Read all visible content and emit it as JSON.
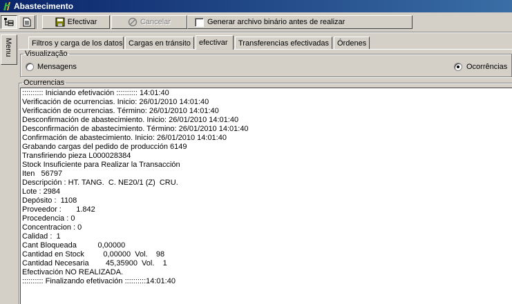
{
  "window": {
    "title": "Abastecimento"
  },
  "toolbar": {
    "efectivar_label": "Efectivar",
    "cancelar_label": "Cancelar",
    "binary_checkbox_label": "Generar archivo binário antes de realizar",
    "binary_checked": false
  },
  "sidebar": {
    "menu_label": "Menu"
  },
  "tabs": [
    {
      "label": "Filtros y carga de los datos",
      "active": false
    },
    {
      "label": "Cargas en tránsito",
      "active": false
    },
    {
      "label": "efectivar",
      "active": true
    },
    {
      "label": "Transferencias efectivadas",
      "active": false
    },
    {
      "label": "Órdenes",
      "active": false
    }
  ],
  "visualizacion": {
    "legend": "Visualização",
    "option_mensagens": "Mensagens",
    "option_ocorrencias": "Ocorrências",
    "selected": "Ocorrências"
  },
  "ocurrencias": {
    "legend": "Ocurrencias",
    "lines": [
      ":::::::::: Iniciando efetivación :::::::::: 14:01:40",
      "Verificación de ocurrencias. Inicio: 26/01/2010 14:01:40",
      "Verificación de ocurrencias. Término: 26/01/2010 14:01:40",
      "Desconfirmación de abastecimiento. Inicio: 26/01/2010 14:01:40",
      "Desconfirmación de abastecimiento. Término: 26/01/2010 14:01:40",
      "Confirmación de abastecimiento. Inicio: 26/01/2010 14:01:40",
      "Grabando cargas del pedido de producción 6149",
      "Transfiriendo pieza L000028384",
      "Stock Insuficiente para Realizar la Transacción",
      "Iten   56797",
      "Descripción : HT. TANG.  C. NE20/1 (Z)  CRU.",
      "Lote : 2984",
      "Depósito :  1108",
      "Proveedor :       1.842",
      "Procedencia : 0",
      "Concentracion : 0",
      "Calidad :  1",
      "Cant Bloqueada          0,00000",
      "Cantidad en Stock         0,00000  Vol.    98",
      "Cantidad Necesaria        45,35900  Vol.    1",
      "Efectivación NO REALIZADA.",
      ":::::::::: Finalizando efetivación ::::::::::14:01:40"
    ]
  }
}
